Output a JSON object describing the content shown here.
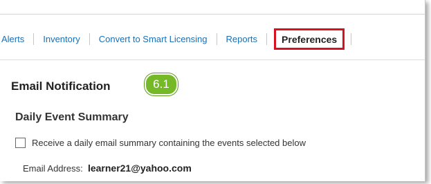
{
  "tabs": [
    {
      "label": "Alerts",
      "active": false
    },
    {
      "label": "Inventory",
      "active": false
    },
    {
      "label": "Convert to Smart Licensing",
      "active": false
    },
    {
      "label": "Reports",
      "active": false
    },
    {
      "label": "Preferences",
      "active": true
    }
  ],
  "section": {
    "title": "Email Notification",
    "step_badge": "6.1"
  },
  "daily_summary": {
    "title": "Daily Event Summary",
    "checkbox_label": "Receive a daily email summary containing the events selected below",
    "checkbox_checked": false,
    "email_label": "Email Address:",
    "email_value": "learner21@yahoo.com"
  },
  "colors": {
    "link": "#1a6fb5",
    "highlight_border": "#d7121f",
    "badge": "#76b928"
  }
}
